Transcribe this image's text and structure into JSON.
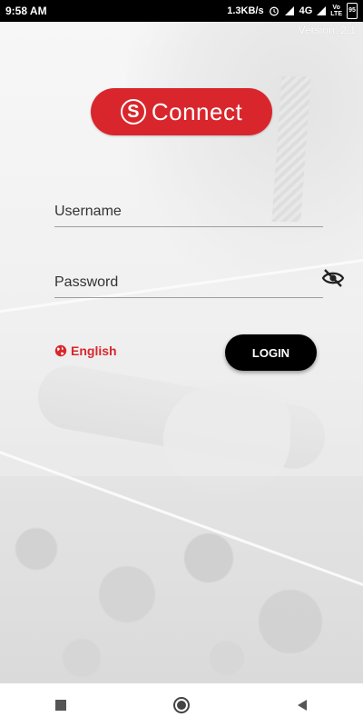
{
  "status_bar": {
    "time": "9:58 AM",
    "speed": "1.3KB/s",
    "network": "4G",
    "volte_top": "Vo",
    "volte_bottom": "LTE",
    "battery": "95"
  },
  "version_label": "Version: 2.1",
  "logo": {
    "text": "Connect",
    "mark": "S"
  },
  "form": {
    "username_placeholder": "Username",
    "password_placeholder": "Password"
  },
  "language": {
    "label": "English"
  },
  "login_button": {
    "label": "LOGIN"
  },
  "colors": {
    "brand_red": "#d9262c",
    "button_black": "#000000"
  },
  "icons": {
    "password_toggle": "eye-off-icon",
    "language": "globe-icon",
    "nav_recents": "square-icon",
    "nav_home": "circle-icon",
    "nav_back": "triangle-back-icon"
  }
}
